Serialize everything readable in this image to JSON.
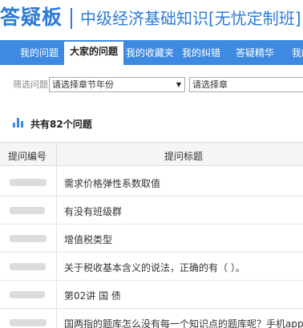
{
  "header": {
    "brand": "答疑板",
    "course_title": "中级经济基础知识[无忧定制班]"
  },
  "tabs": [
    {
      "label": "我的问题"
    },
    {
      "label": "大家的问题"
    },
    {
      "label": "我的收藏夹"
    },
    {
      "label": "我的纠错"
    },
    {
      "label": "答疑精华"
    },
    {
      "label": "我的"
    }
  ],
  "active_tab": "大家的问题",
  "filter": {
    "label": "筛选问题",
    "year_select": "请选择章节年份",
    "chapter_select": "请选择章"
  },
  "summary": {
    "icon": "bar-chart-icon",
    "text": "共有82个问题"
  },
  "table": {
    "headers": [
      "提问编号",
      "提问标题"
    ],
    "rows": [
      {
        "title": "需求价格弹性系数取值"
      },
      {
        "title": "有没有班级群"
      },
      {
        "title": "增值税类型"
      },
      {
        "title": "关于税收基本含义的说法，正确的有（ ）。"
      },
      {
        "title": "第02讲  国  债"
      },
      {
        "title": "国两指的题库怎么没有每一个知识点的题库呢？手机app端"
      }
    ]
  },
  "colors": {
    "brand_blue": "#2e7bd6",
    "tab_bar": "#3d8ae0"
  }
}
